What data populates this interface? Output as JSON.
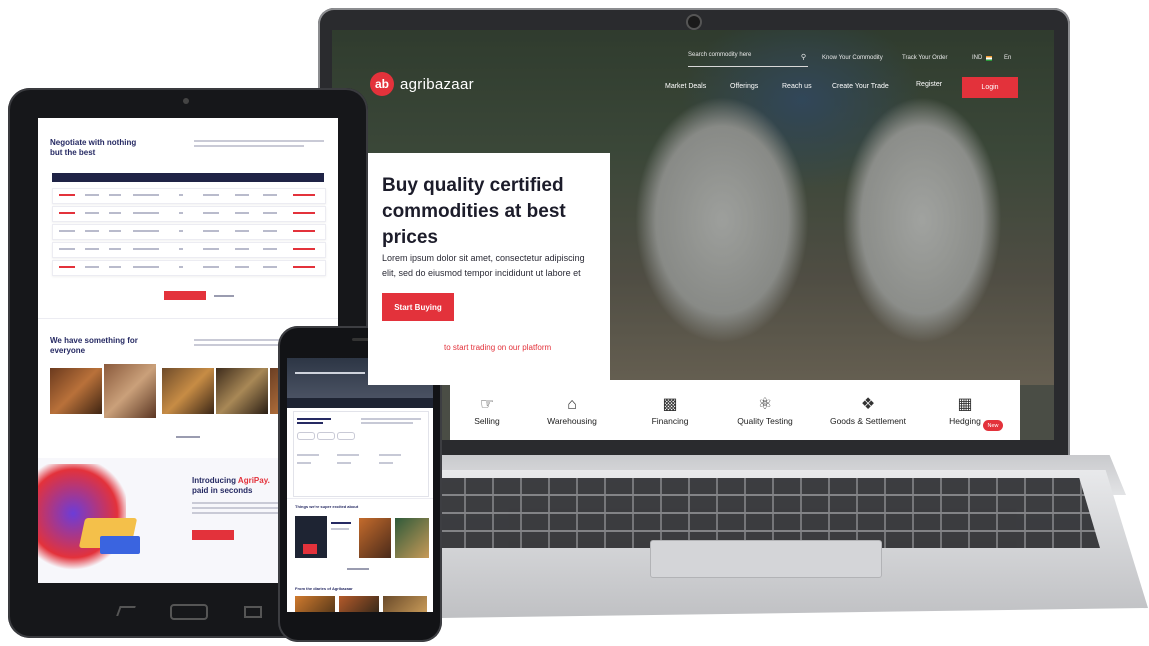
{
  "laptop": {
    "brand": {
      "logo_glyph": "ab",
      "name": "agribazaar"
    },
    "search": {
      "placeholder": "Search commodity here",
      "icon": "search-icon"
    },
    "top_links": [
      "Know Your Commodity",
      "Track Your Order",
      "IND",
      "En"
    ],
    "nav": [
      "Market Deals",
      "Offerings",
      "Reach us",
      "Create Your Trade",
      "Register"
    ],
    "login_label": "Login",
    "hero": {
      "title": "Buy quality certified commodities at best prices",
      "body": "Lorem ipsum dolor sit amet, consectetur adipiscing elit, sed do eiusmod tempor incididunt ut labore et",
      "cta_label": "Start Buying",
      "link_text": "to start trading on our platform"
    },
    "services": [
      {
        "label": "Selling",
        "icon": "hand-tap-icon"
      },
      {
        "label": "Warehousing",
        "icon": "warehouse-icon"
      },
      {
        "label": "Financing",
        "icon": "finance-icon"
      },
      {
        "label": "Quality Testing",
        "icon": "microscope-icon"
      },
      {
        "label": "Goods & Settlement",
        "icon": "handshake-icon"
      },
      {
        "label": "Hedging",
        "icon": "hedging-icon"
      }
    ],
    "new_badge": "New"
  },
  "tablet": {
    "heading1": "Negotiate with nothing but the best",
    "heading2": "We have something for everyone",
    "heading3_prefix": "Introducing ",
    "heading3_accent": "AgriPay.",
    "heading3_rest": "paid in seconds"
  },
  "phone": {
    "section_heading": "Things we're super excited about",
    "footer_heading": "From the diaries of Agribazaar"
  },
  "colors": {
    "accent": "#e3323b",
    "navy": "#262a63"
  }
}
